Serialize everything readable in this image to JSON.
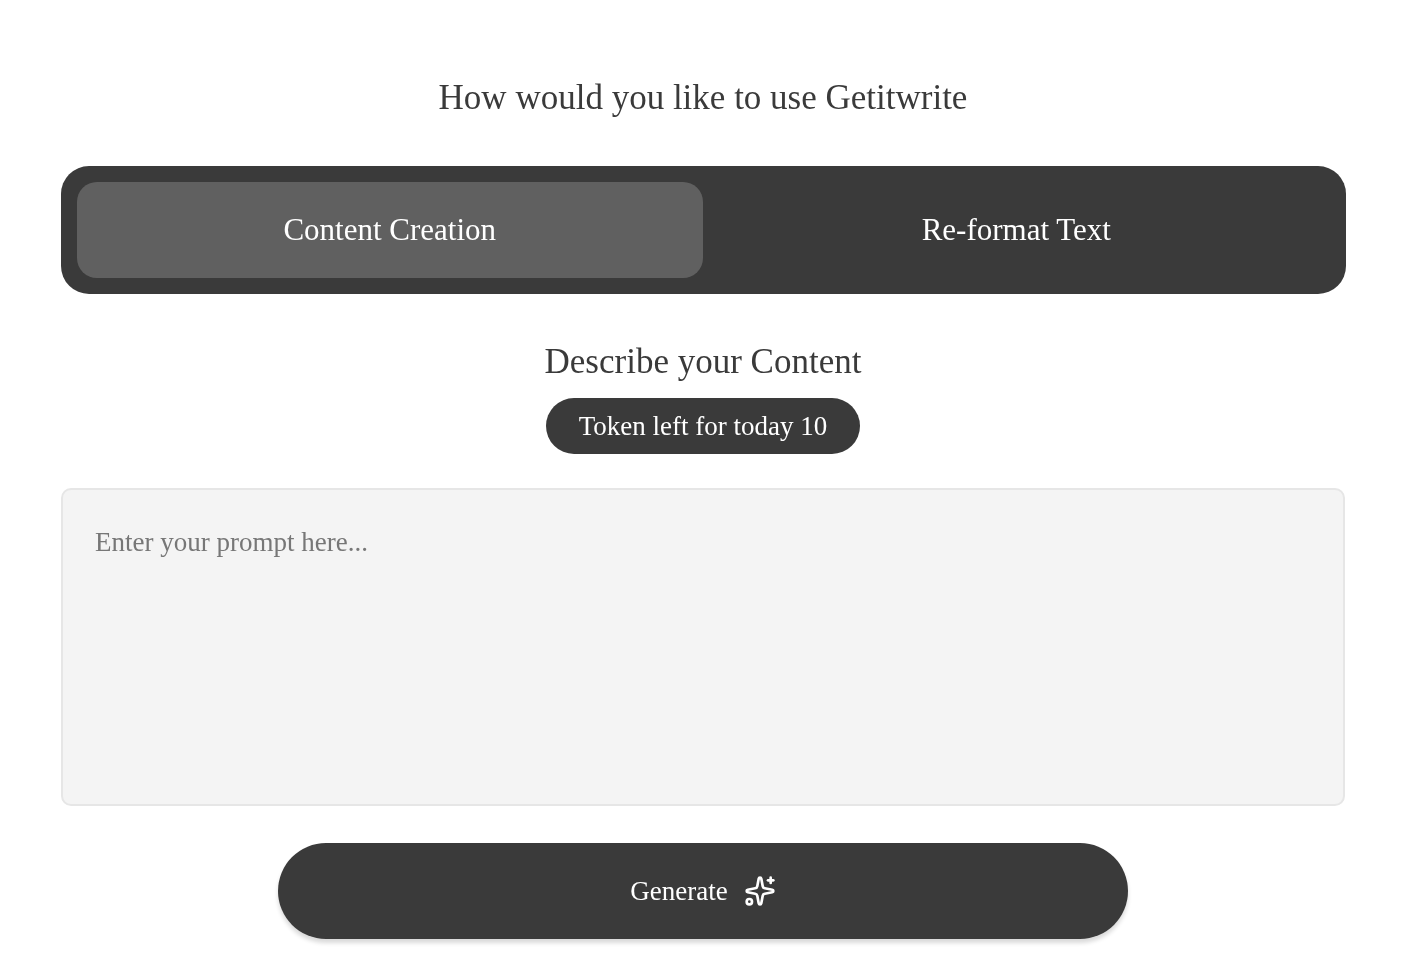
{
  "heading": "How would you like to use Getitwrite",
  "tabs": [
    {
      "label": "Content Creation",
      "selected": true
    },
    {
      "label": "Re-format Text",
      "selected": false
    }
  ],
  "section_title": "Describe your Content",
  "token_badge": "Token left for today 10",
  "prompt": {
    "placeholder": "Enter your prompt here..."
  },
  "generate_button": "Generate"
}
